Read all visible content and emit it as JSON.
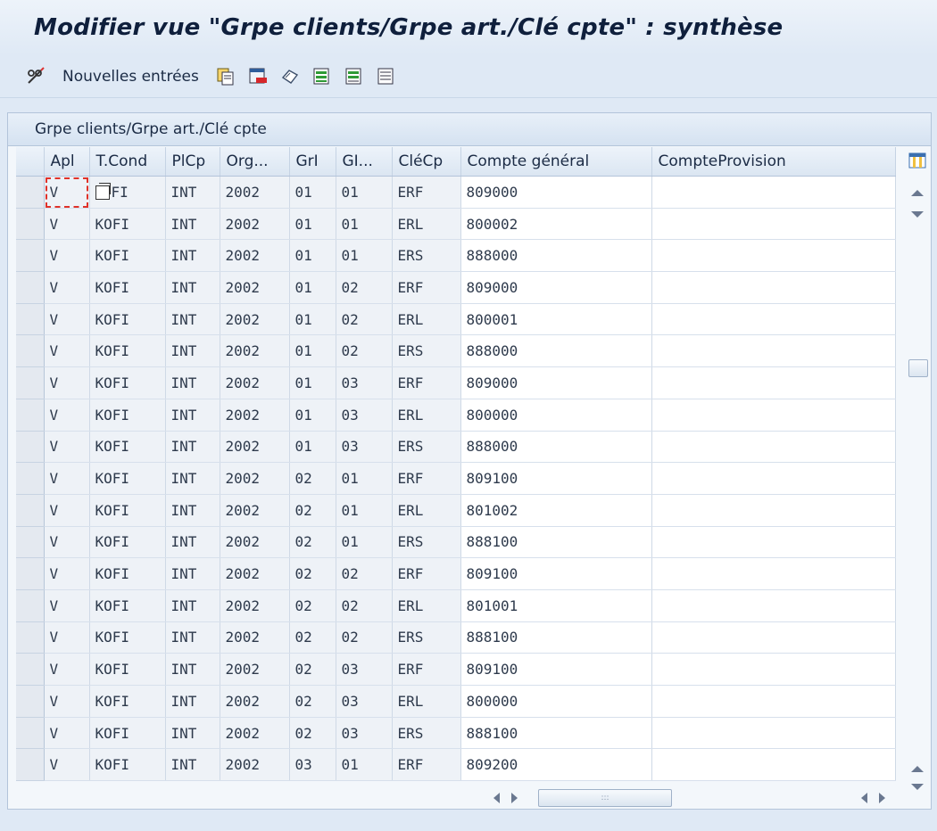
{
  "window": {
    "title": "Modifier vue \"Grpe clients/Grpe art./Clé cpte\" : synthèse"
  },
  "toolbar": {
    "items": [
      {
        "icon": "edit-glasses-icon"
      },
      {
        "label": "Nouvelles entrées"
      },
      {
        "icon": "copy-icon"
      },
      {
        "icon": "delete-icon"
      },
      {
        "icon": "undo-icon"
      },
      {
        "icon": "select-all-icon"
      },
      {
        "icon": "select-block-icon"
      },
      {
        "icon": "deselect-all-icon"
      }
    ],
    "new_entries_label": "Nouvelles entrées"
  },
  "panel": {
    "header": "Grpe clients/Grpe art./Clé cpte"
  },
  "table": {
    "columns": [
      "Apl",
      "T.Cond",
      "PlCp",
      "Org...",
      "GrI",
      "GI...",
      "CléCp",
      "Compte général",
      "CompteProvision"
    ],
    "rows": [
      [
        "V",
        "KOFI",
        "INT",
        "2002",
        "01",
        "01",
        "ERF",
        "809000",
        ""
      ],
      [
        "V",
        "KOFI",
        "INT",
        "2002",
        "01",
        "01",
        "ERL",
        "800002",
        ""
      ],
      [
        "V",
        "KOFI",
        "INT",
        "2002",
        "01",
        "01",
        "ERS",
        "888000",
        ""
      ],
      [
        "V",
        "KOFI",
        "INT",
        "2002",
        "01",
        "02",
        "ERF",
        "809000",
        ""
      ],
      [
        "V",
        "KOFI",
        "INT",
        "2002",
        "01",
        "02",
        "ERL",
        "800001",
        ""
      ],
      [
        "V",
        "KOFI",
        "INT",
        "2002",
        "01",
        "02",
        "ERS",
        "888000",
        ""
      ],
      [
        "V",
        "KOFI",
        "INT",
        "2002",
        "01",
        "03",
        "ERF",
        "809000",
        ""
      ],
      [
        "V",
        "KOFI",
        "INT",
        "2002",
        "01",
        "03",
        "ERL",
        "800000",
        ""
      ],
      [
        "V",
        "KOFI",
        "INT",
        "2002",
        "01",
        "03",
        "ERS",
        "888000",
        ""
      ],
      [
        "V",
        "KOFI",
        "INT",
        "2002",
        "02",
        "01",
        "ERF",
        "809100",
        ""
      ],
      [
        "V",
        "KOFI",
        "INT",
        "2002",
        "02",
        "01",
        "ERL",
        "801002",
        ""
      ],
      [
        "V",
        "KOFI",
        "INT",
        "2002",
        "02",
        "01",
        "ERS",
        "888100",
        ""
      ],
      [
        "V",
        "KOFI",
        "INT",
        "2002",
        "02",
        "02",
        "ERF",
        "809100",
        ""
      ],
      [
        "V",
        "KOFI",
        "INT",
        "2002",
        "02",
        "02",
        "ERL",
        "801001",
        ""
      ],
      [
        "V",
        "KOFI",
        "INT",
        "2002",
        "02",
        "02",
        "ERS",
        "888100",
        ""
      ],
      [
        "V",
        "KOFI",
        "INT",
        "2002",
        "02",
        "03",
        "ERF",
        "809100",
        ""
      ],
      [
        "V",
        "KOFI",
        "INT",
        "2002",
        "02",
        "03",
        "ERL",
        "800000",
        ""
      ],
      [
        "V",
        "KOFI",
        "INT",
        "2002",
        "02",
        "03",
        "ERS",
        "888100",
        ""
      ],
      [
        "V",
        "KOFI",
        "INT",
        "2002",
        "03",
        "01",
        "ERF",
        "809200",
        ""
      ]
    ],
    "first_row_tcond_suffix": "FI"
  },
  "colors": {
    "background": "#dfe9f5",
    "grid_header": "#dbe6f2",
    "focus": "#e0322a"
  }
}
